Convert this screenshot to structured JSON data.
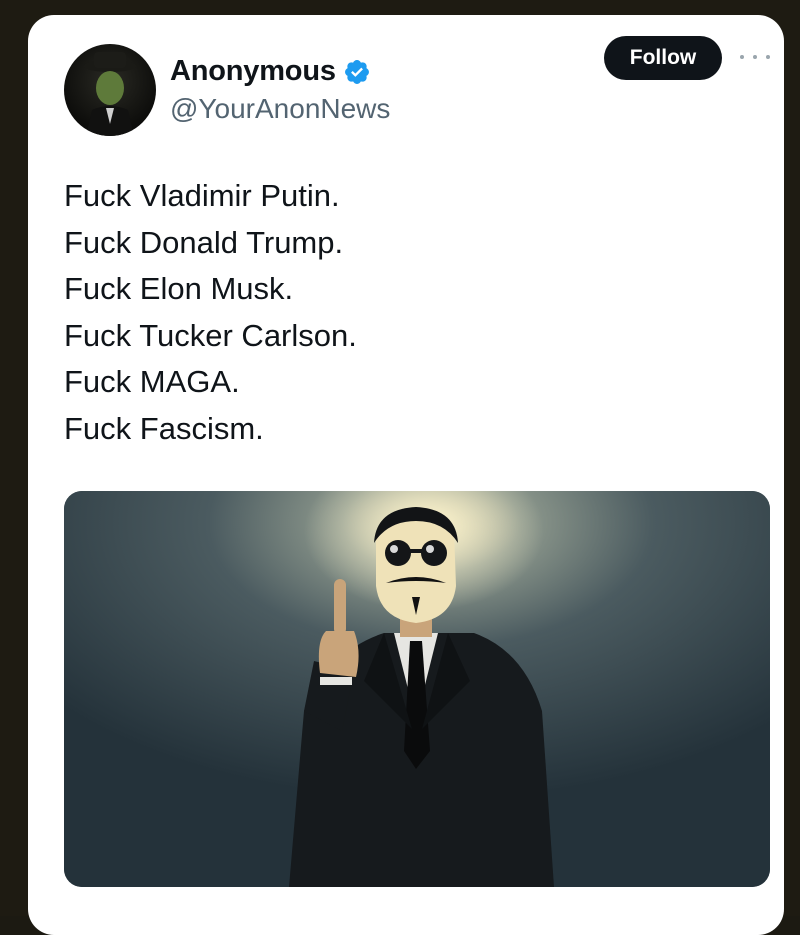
{
  "author": {
    "display_name": "Anonymous",
    "handle": "@YourAnonNews",
    "verified": true,
    "avatar_icon": "masked-figure-avatar"
  },
  "actions": {
    "follow_label": "Follow",
    "more_icon": "more-options-icon"
  },
  "tweet": {
    "lines": [
      "Fuck Vladimir Putin.",
      "Fuck Donald Trump.",
      "Fuck Elon Musk.",
      "Fuck Tucker Carlson.",
      "Fuck MAGA.",
      "Fuck Fascism."
    ]
  },
  "media": {
    "icon": "masked-man-photo"
  },
  "colors": {
    "text_primary": "#0f1419",
    "text_secondary": "#536471",
    "verified_blue": "#1d9bf0",
    "follow_bg": "#0f1419"
  }
}
